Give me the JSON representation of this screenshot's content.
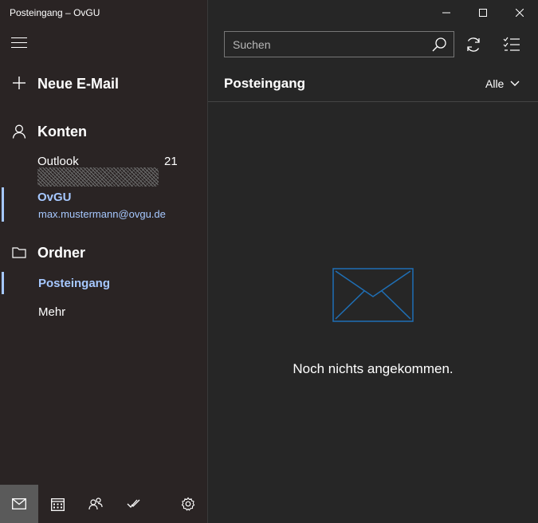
{
  "window": {
    "title": "Posteingang – OvGU"
  },
  "nav": {
    "new_mail_label": "Neue E-Mail",
    "accounts_label": "Konten",
    "folders_label": "Ordner"
  },
  "accounts": [
    {
      "name": "Outlook",
      "count": "21"
    },
    {
      "name": "OvGU",
      "email": "max.mustermann@ovgu.de",
      "selected": true
    }
  ],
  "folders": [
    {
      "label": "Posteingang",
      "selected": true
    },
    {
      "label": "Mehr"
    }
  ],
  "search": {
    "placeholder": "Suchen"
  },
  "main": {
    "title": "Posteingang",
    "filter_label": "Alle",
    "empty_message": "Noch nichts angekommen."
  },
  "colors": {
    "accent": "#a6c8ff",
    "empty_icon": "#1f6fb5",
    "sidebar_bg": "#2a2424",
    "main_bg": "#262626"
  },
  "bottom_nav": [
    "mail-icon",
    "calendar-icon",
    "people-icon",
    "todo-icon",
    "settings-icon"
  ]
}
